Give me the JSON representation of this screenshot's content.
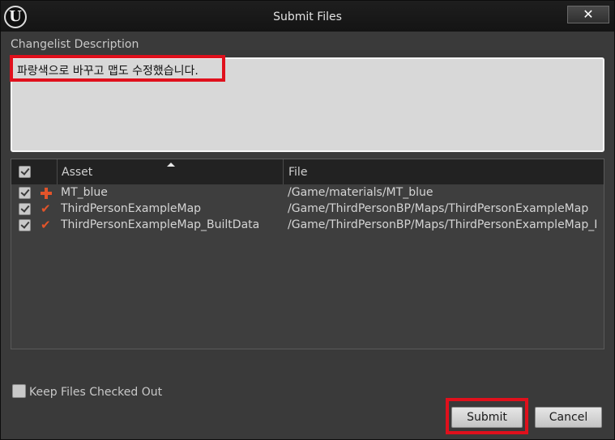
{
  "window": {
    "title": "Submit Files",
    "logo_letter": "U",
    "close_glyph": "✕"
  },
  "description": {
    "label": "Changelist Description",
    "value": "파랑색으로 바꾸고 맵도 수정했습니다."
  },
  "file_list": {
    "columns": {
      "asset": "Asset",
      "file": "File"
    },
    "rows": [
      {
        "checked": true,
        "status_icon": "add-icon",
        "asset": "MT_blue",
        "file": "/Game/materials/MT_blue"
      },
      {
        "checked": true,
        "status_icon": "checkmark-icon",
        "asset": "ThirdPersonExampleMap",
        "file": "/Game/ThirdPersonBP/Maps/ThirdPersonExampleMap"
      },
      {
        "checked": true,
        "status_icon": "checkmark-icon",
        "asset": "ThirdPersonExampleMap_BuiltData",
        "file": "/Game/ThirdPersonBP/Maps/ThirdPersonExampleMap_I"
      }
    ]
  },
  "keep_checked_out": {
    "label": "Keep Files Checked Out",
    "checked": false
  },
  "buttons": {
    "submit": "Submit",
    "cancel": "Cancel"
  },
  "colors": {
    "highlight": "#e0101c",
    "status_orange": "#e2542a"
  },
  "icons": {
    "check_glyph": "✔"
  }
}
